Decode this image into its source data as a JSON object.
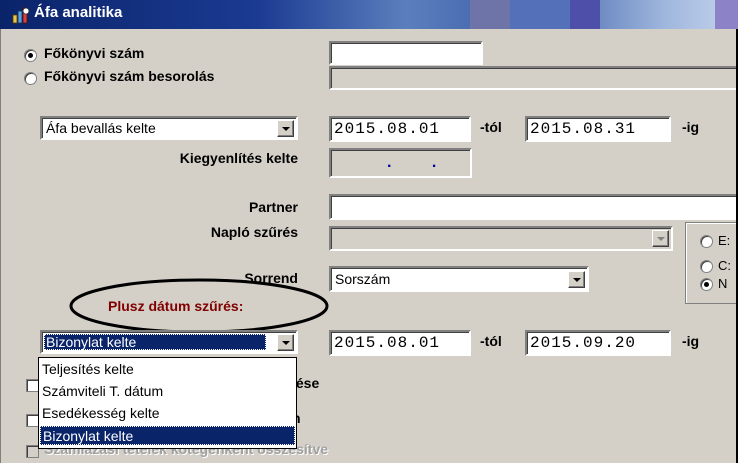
{
  "window": {
    "title": "Áfa analitika",
    "icon": "analytics-icon"
  },
  "radio_options": [
    {
      "label": "Főkönyvi szám",
      "selected": true
    },
    {
      "label": "Főkönyvi szám besorolás",
      "selected": false
    }
  ],
  "fokonyvi_szam_value": "",
  "besorolas_value": "",
  "date_filter_1": {
    "select_value": "Áfa bevallás kelte",
    "from": "2015.08.01",
    "from_suffix": "-tól",
    "to": "2015.08.31",
    "to_suffix": "-ig"
  },
  "kiegyenlites": {
    "label": "Kiegyenlítés kelte",
    "value": ". ."
  },
  "partner": {
    "label": "Partner",
    "value": ""
  },
  "naplo": {
    "label": "Napló szűrés",
    "value": ""
  },
  "sorrend": {
    "label": "Sorrend",
    "value": "Sorszám"
  },
  "plusz_datum": {
    "label": "Plusz dátum szűrés:",
    "highlight_color": "#800000"
  },
  "date_filter_2": {
    "select_value": "Bizonylat kelte",
    "from": "2015.08.01",
    "from_suffix": "-tól",
    "to": "2015.09.20",
    "to_suffix": "-ig"
  },
  "right_radios": [
    {
      "label": "E:",
      "selected": false
    },
    {
      "label": "C:",
      "selected": false
    },
    {
      "label": "N",
      "selected": true
    }
  ],
  "dropdown_options": [
    "Teljesítés kelte",
    "Számviteli T. dátum",
    "Esedékesség kelte",
    "Bizonylat kelte"
  ],
  "dropdown_selected_index": 3,
  "checkboxes": [
    {
      "label": "lése",
      "checked": false
    },
    {
      "label": "n",
      "checked": false
    },
    {
      "label": "Számlázási tételek kötegenként összesítve",
      "checked": false
    }
  ],
  "colors": {
    "title_start": "#0a246a",
    "selection": "#0a246a",
    "panel": "#d4d0c8"
  }
}
